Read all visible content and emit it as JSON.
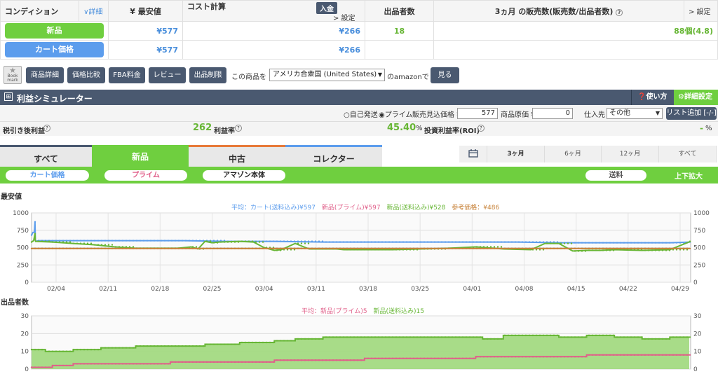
{
  "top_table": {
    "headers": {
      "condition": "コンディション",
      "detail": "∨詳細",
      "lowest": "¥ 最安値",
      "cost": "コスト計算",
      "cost_badge": "入金",
      "cost_setting": "> 設定",
      "sellers": "出品者数",
      "sales": "3ヵ月 の販売数(販売数/出品者数)",
      "sales_setting": "> 設定"
    },
    "rows": [
      {
        "label": "新品",
        "lowest": "¥577",
        "cost": "¥266",
        "sellers": "18",
        "sales": "88個(4.8)"
      },
      {
        "label": "カート価格",
        "lowest": "¥577",
        "cost": "¥266",
        "sellers": "",
        "sales": ""
      }
    ]
  },
  "toolbar": {
    "bookmark": "Book mark",
    "buttons": [
      "商品詳細",
      "価格比較",
      "FBA料金",
      "レビュー",
      "出品制限"
    ],
    "product_label": "この商品を",
    "marketplace": "アメリカ合衆国 (United States)",
    "suffix": "のamazonで",
    "view": "見る"
  },
  "simulator": {
    "title": "利益シミュレーター",
    "howto": "使い方",
    "settings": "詳細設定",
    "ship_self": "自己発送",
    "ship_prime": "プライム",
    "sell_price_label": "販売見込価格 ¥",
    "sell_price": "577",
    "cost_label": "商品原価 ¥",
    "cost": "0",
    "supplier_label": "仕入先",
    "supplier": "その他",
    "add_list": "リスト追加 [-/-]",
    "after_tax_label": "税引き後利益",
    "after_tax": "262",
    "margin_label": "利益率",
    "margin": "45.40",
    "margin_unit": "%",
    "roi_label": "投資利益率(ROI)",
    "roi": "-",
    "roi_unit": "%"
  },
  "tabs": [
    "すべて",
    "新品",
    "中古",
    "コレクター"
  ],
  "ranges": [
    "3ヶ月",
    "6ヶ月",
    "12ヶ月",
    "すべて"
  ],
  "filters": {
    "cart": "カート価格",
    "prime": "プライム",
    "amazon": "アマゾン本体",
    "shipping": "送料",
    "expand": "上下拡大"
  },
  "colors": {
    "accent": "#6fcf3f",
    "navy": "#4a5970",
    "blue": "#5c9ded",
    "pink": "#e0608a",
    "orange": "#c8833a"
  },
  "chart_data": [
    {
      "type": "line",
      "title": "最安値",
      "legend": {
        "avg_label": "平均：",
        "cart": "カート(送料込み)¥597",
        "prime": "新品(プライム)¥597",
        "new": "新品(送料込み)¥528",
        "ref": "参考価格：¥486"
      },
      "ylim": [
        0,
        1000
      ],
      "yticks": [
        0,
        250,
        500,
        750,
        1000
      ],
      "xticks": [
        "02/04",
        "02/11",
        "02/18",
        "02/25",
        "03/04",
        "03/11",
        "03/18",
        "03/25",
        "04/01",
        "04/08",
        "04/15",
        "04/22",
        "04/29"
      ],
      "series": [
        {
          "name": "カート(送料込み)",
          "color": "#5c9ded",
          "x": [
            0,
            2,
            4,
            5,
            5.5,
            6,
            10,
            40,
            120,
            220,
            280,
            350,
            420,
            540,
            640,
            700,
            760,
            830,
            920,
            950
          ],
          "values": [
            680,
            720,
            720,
            870,
            620,
            590,
            600,
            600,
            600,
            600,
            590,
            590,
            580,
            580,
            580,
            580,
            570,
            570,
            570,
            580
          ]
        },
        {
          "name": "新品(送料込み)",
          "color": "#67b635",
          "x": [
            0,
            3,
            5,
            5.5,
            6,
            30,
            60,
            90,
            120,
            150,
            180,
            210,
            230,
            240,
            250,
            260,
            270,
            300,
            320,
            335,
            350,
            360,
            380,
            400,
            420,
            440,
            450,
            480,
            520,
            560,
            600,
            640,
            680,
            720,
            740,
            760,
            780,
            800,
            820,
            840,
            880,
            920,
            950
          ],
          "values": [
            580,
            600,
            700,
            600,
            590,
            580,
            560,
            540,
            510,
            490,
            490,
            490,
            510,
            480,
            590,
            570,
            580,
            590,
            580,
            500,
            460,
            470,
            560,
            480,
            480,
            480,
            470,
            470,
            470,
            480,
            490,
            510,
            480,
            470,
            560,
            560,
            450,
            460,
            460,
            470,
            460,
            470,
            590
          ]
        },
        {
          "name": "参考価格",
          "color": "#c8833a",
          "x": [
            0,
            950
          ],
          "values": [
            486,
            486
          ]
        }
      ]
    },
    {
      "type": "area",
      "title": "出品者数",
      "legend": {
        "avg_label": "平均：",
        "prime": "新品(プライム)5",
        "new": "新品(送料込み)15"
      },
      "ylim": [
        0,
        30
      ],
      "yticks": [
        0,
        10,
        20,
        30
      ],
      "series": [
        {
          "name": "新品(送料込み)",
          "color": "#67b635",
          "x": [
            0,
            20,
            60,
            100,
            150,
            200,
            250,
            300,
            350,
            380,
            420,
            460,
            500,
            560,
            620,
            650,
            680,
            720,
            760,
            800,
            840,
            880,
            920,
            950
          ],
          "values": [
            11,
            10,
            11,
            12,
            13,
            13,
            14,
            15,
            16,
            17,
            18,
            18,
            18,
            18,
            18,
            17,
            19,
            19,
            18,
            19,
            18,
            17,
            18,
            18
          ]
        },
        {
          "name": "新品(プライム)",
          "color": "#e0608a",
          "x": [
            0,
            30,
            60,
            120,
            200,
            280,
            350,
            420,
            480,
            560,
            640,
            720,
            800,
            880,
            950
          ],
          "values": [
            1,
            2,
            3,
            3,
            4,
            4,
            5,
            5,
            6,
            6,
            7,
            7,
            8,
            8,
            8
          ]
        }
      ]
    }
  ]
}
